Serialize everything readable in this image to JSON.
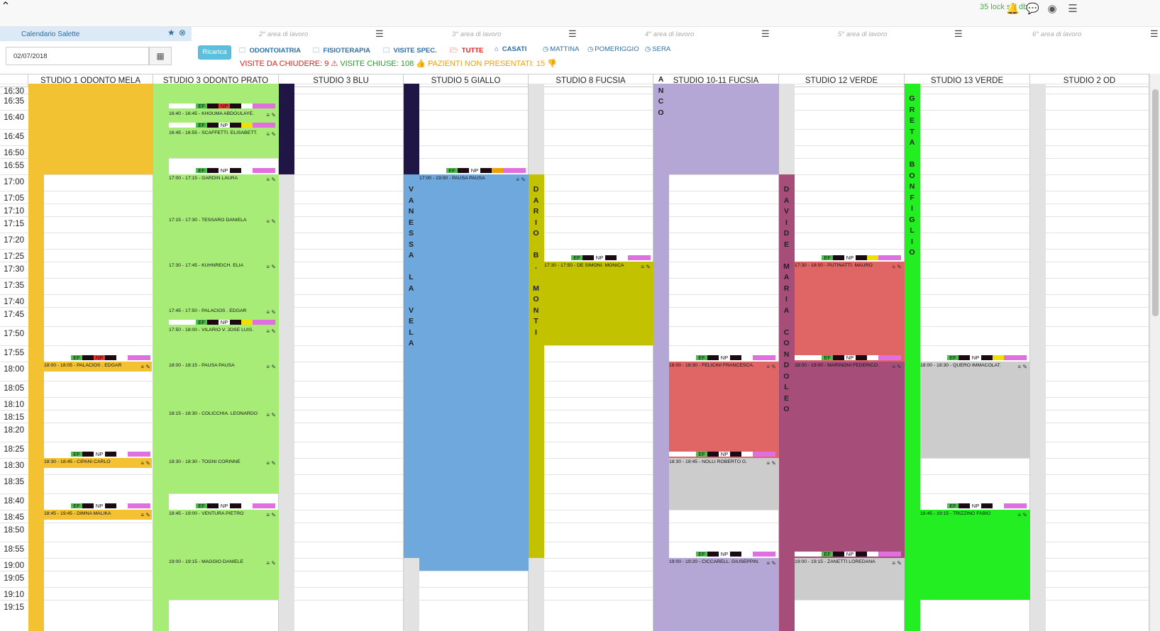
{
  "topbar": {
    "lock_text": "35 lock sul db"
  },
  "areas": [
    {
      "label": "Calendario Salette"
    },
    {
      "label": "2° area di lavoro"
    },
    {
      "label": "3° area di lavoro"
    },
    {
      "label": "4° area di lavoro"
    },
    {
      "label": "5° area di lavoro"
    },
    {
      "label": "6° area di lavoro"
    }
  ],
  "date": {
    "value": "02/07/2018"
  },
  "ricarica_label": "Ricarica",
  "filters": [
    "ODONTOIATRIA",
    "FISIOTERAPIA",
    "VISITE SPEC.",
    "TUTTE",
    "CASATI",
    "MATTINA",
    "POMERIGGIO",
    "SERA"
  ],
  "counters": {
    "da_chiudere": "VISITE DA CHIUDERE: 9",
    "chiuse": "VISITE CHIUSE: 108",
    "non_presentati": "PAZIENTI NON PRESENTATI: 15"
  },
  "studios": [
    "STUDIO 1 ODONTO MELA",
    "STUDIO 3 ODONTO PRATO",
    "STUDIO 3 BLU",
    "STUDIO 5 GIALLO",
    "STUDIO 8 FUCSIA",
    "STUDIO 10-11 FUCSIA",
    "STUDIO 12 VERDE",
    "STUDIO 13 VERDE",
    "STUDIO 2 OD"
  ],
  "times": [
    "16:30",
    "16:35",
    "16:40",
    "16:45",
    "16:50",
    "16:55",
    "17:00",
    "17:05",
    "17:10",
    "17:15",
    "17:20",
    "17:25",
    "17:30",
    "17:35",
    "17:40",
    "17:45",
    "17:50",
    "17:55",
    "18:00",
    "18:05",
    "18:10",
    "18:15",
    "18:20",
    "18:25",
    "18:30",
    "18:35",
    "18:40",
    "18:45",
    "18:50",
    "18:55",
    "19:00",
    "19:05",
    "19:10",
    "19:15"
  ],
  "vertical_names": [
    {
      "text": "ANCO"
    },
    {
      "text": "VANESSA LA VELA"
    },
    {
      "text": "DARIO B. MONTI"
    },
    {
      "text": "DAVIDE MARIA CONDOLEO"
    },
    {
      "text": "GRETA BONFIGLIO"
    }
  ],
  "appointments": [
    {
      "label": "16:40 - 16:45 - KHOUMA ABDOULAYE."
    },
    {
      "label": "16:45 - 16:55 - SCAFFETTI. ELISABETT."
    },
    {
      "label": "17:00 - 17:15 - GARDIN LAURA"
    },
    {
      "label": "17:15 - 17:30 - TESSARO DANIELA"
    },
    {
      "label": "17:30 - 17:45 - KUHNREICH. ELIA"
    },
    {
      "label": "17:45 - 17:50 - PALACIOS . EDGAR"
    },
    {
      "label": "17:50 - 18:00 - VILARIO V. JOSE LUIS."
    },
    {
      "label": "18:00 - 18:15 - PAUSA PAUSA"
    },
    {
      "label": "18:15 - 18:30 - COLICCHIA. LEONARDO"
    },
    {
      "label": "18:30 - 18:30 - TOGNI CORINNE"
    },
    {
      "label": "18:45 - 19:00 - VENTURA PIETRO"
    },
    {
      "label": "19:00 - 19:15 - MAGGIO DANIELE"
    },
    {
      "label": "18:00 - 18:05 - PALACIOS . EDGAR"
    },
    {
      "label": "18:30 - 18:45 - CIPANI CARLO"
    },
    {
      "label": "18:45 - 19:45 - DIMNA MALIKA"
    },
    {
      "label": "17:00 - 19:00 - PAUSA PAUSA"
    },
    {
      "label": "17:30 - 17:50 - DE SIMONI. MONICA"
    },
    {
      "label": "18:00 - 18:30 - FELICINI FRANCESCA."
    },
    {
      "label": "18:30 - 18:45 - NOLLI ROBERTO G."
    },
    {
      "label": "19:00 - 19:20 - CICCARELL. GIUSEPPIN."
    },
    {
      "label": "17:30 - 18:00 - PUTINATTI. MAURO"
    },
    {
      "label": "18:00 - 19:00 - MARINONI FEDERICO ."
    },
    {
      "label": "19:00 - 19:15 - ZANETTI LOREDANA"
    },
    {
      "label": "18:00 - 18:30 - QUERO IMMACOLAT."
    },
    {
      "label": "18:45 - 19:15 - TRIZZINO FABIO"
    }
  ],
  "strip_labels": {
    "ef": "EF",
    "np": "NP"
  }
}
